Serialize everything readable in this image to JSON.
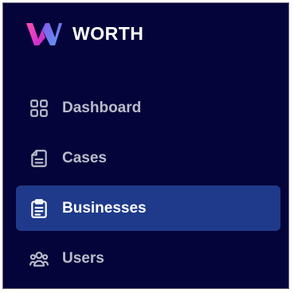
{
  "brand": {
    "name": "WORTH",
    "logo_colors": [
      "#ff4fb0",
      "#8b5cf6",
      "#60a5fa"
    ]
  },
  "sidebar": {
    "items": [
      {
        "label": "Dashboard",
        "icon": "dashboard-grid-icon",
        "active": false
      },
      {
        "label": "Cases",
        "icon": "document-icon",
        "active": false
      },
      {
        "label": "Businesses",
        "icon": "clipboard-icon",
        "active": true
      },
      {
        "label": "Users",
        "icon": "users-icon",
        "active": false
      }
    ]
  },
  "colors": {
    "sidebar_bg": "#05043a",
    "active_bg": "#1f3a8a",
    "text_muted": "#b9bccb",
    "text_active": "#ffffff"
  }
}
